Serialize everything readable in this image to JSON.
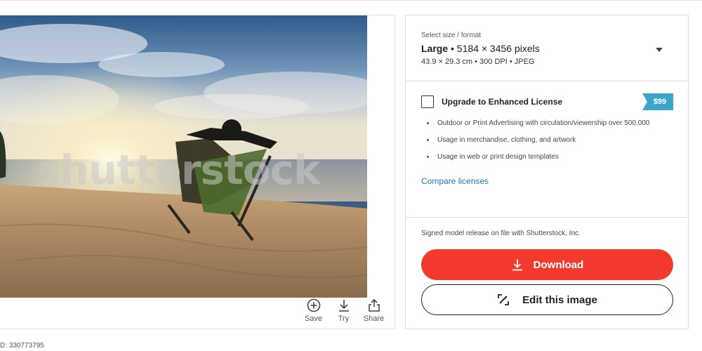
{
  "image": {
    "watermark_text": "shutterstock",
    "id_text": "D: 330773795"
  },
  "image_actions": [
    {
      "label": "Save",
      "icon": "plus-circle-icon"
    },
    {
      "label": "Try",
      "icon": "download-arrow-icon"
    },
    {
      "label": "Share",
      "icon": "share-icon"
    }
  ],
  "size_selector": {
    "caption": "Select size / format",
    "size_name": "Large",
    "pixels": "• 5184 × 3456 pixels",
    "details": "43.9 × 29.3 cm • 300 DPI • JPEG"
  },
  "license": {
    "title": "Upgrade to Enhanced License",
    "price": "$99",
    "items": [
      "Outdoor or Print Advertising with circulation/viewership over 500,000",
      "Usage in merchandise, clothing, and artwork",
      "Usage in web or print design templates"
    ],
    "compare_link": "Compare licenses"
  },
  "release_text": "Signed model release on file with Shutterstock, Inc.",
  "buttons": {
    "download": "Download",
    "edit": "Edit this image"
  },
  "colors": {
    "download_button": "#f43a2f",
    "price_badge": "#3aa6c9",
    "link": "#1b7bb8"
  }
}
